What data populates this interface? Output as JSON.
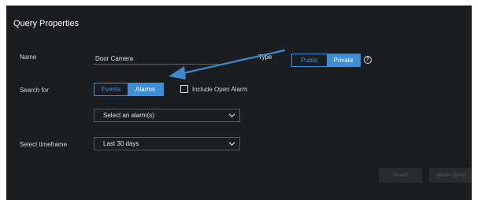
{
  "dialog": {
    "title": "Query Properties"
  },
  "fields": {
    "name_label": "Name",
    "name_value": "Door Camera",
    "type_label": "Type",
    "type_options": [
      "Public",
      "Private"
    ],
    "type_selected": "Private",
    "help_glyph": "?",
    "search_for_label": "Search for",
    "search_for_options": [
      "Events",
      "Alarms"
    ],
    "search_for_selected": "Alarms",
    "include_open_alarm_label": "Include Open Alarm",
    "include_open_alarm_checked": false,
    "alarm_select_value": "Select an alarm(s)",
    "timeframe_label": "Select timeframe",
    "timeframe_value": "Last 30 days"
  },
  "actions": {
    "search_label": "Search",
    "update_query_label": "Update Query",
    "enabled": false
  },
  "annotation": {
    "color": "#3d89c9"
  },
  "colors": {
    "accent": "#3e8fd6",
    "panel_bg": "#1c1d21",
    "text": "#d2d4d8"
  }
}
